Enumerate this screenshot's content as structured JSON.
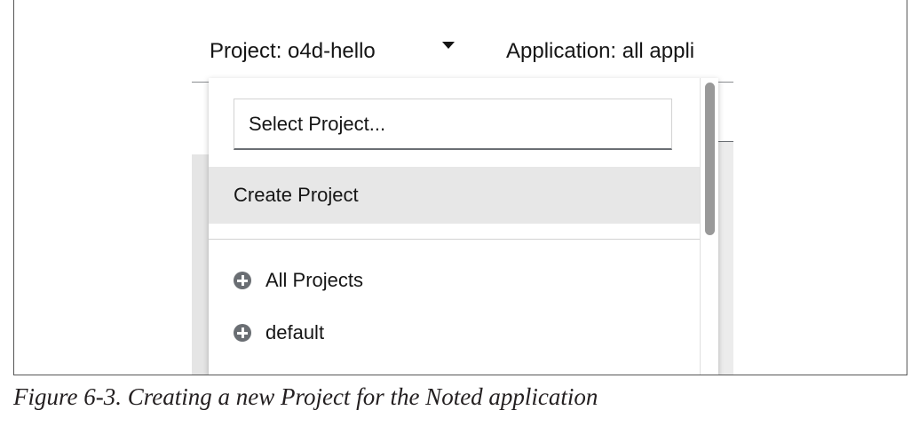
{
  "header": {
    "project_label": "Project: o4d-hello",
    "application_label": "Application: all appli"
  },
  "dropdown": {
    "search": {
      "placeholder": "Select Project..."
    },
    "create_label": "Create Project",
    "items": [
      {
        "label": "All Projects",
        "icon": "plus-circle-icon"
      },
      {
        "label": "default",
        "icon": "plus-circle-icon"
      }
    ]
  },
  "caption": "Figure 6-3. Creating a new Project for the Noted application",
  "colors": {
    "highlight": "#e7e7e7",
    "icon": "#6a6e73",
    "scroll_thumb": "#999999"
  }
}
